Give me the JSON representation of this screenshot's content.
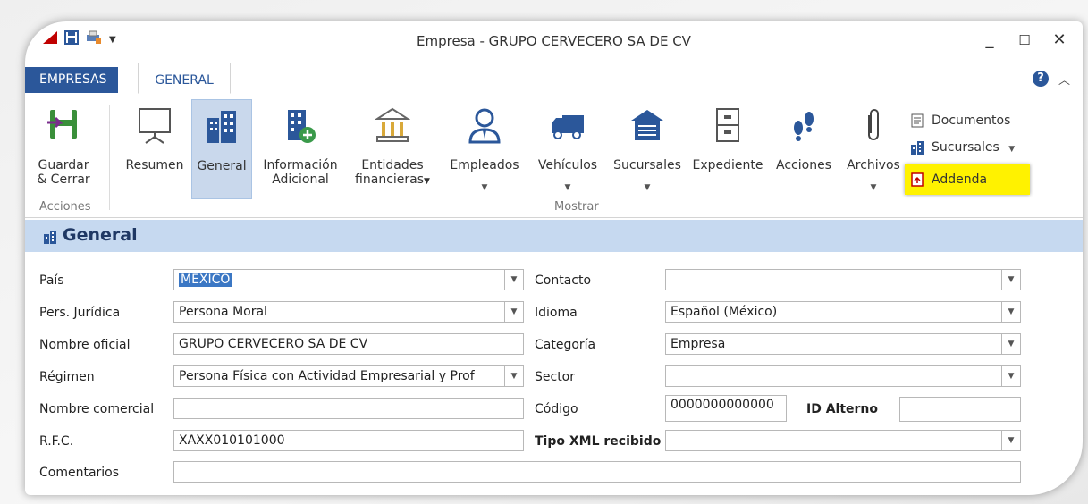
{
  "window": {
    "title": "Empresa - GRUPO CERVECERO SA DE CV"
  },
  "tabs": {
    "empresas": "EMPRESAS",
    "general": "GENERAL"
  },
  "ribbon": {
    "save_close": [
      "Guardar",
      "& Cerrar"
    ],
    "group_acciones": "Acciones",
    "resumen": "Resumen",
    "general": "General",
    "info": [
      "Información",
      "Adicional"
    ],
    "entidades": [
      "Entidades",
      "financieras"
    ],
    "empleados": "Empleados",
    "vehiculos": "Vehículos",
    "sucursales": "Sucursales",
    "expediente": "Expediente",
    "acciones": "Acciones",
    "archivos": "Archivos",
    "group_mostrar": "Mostrar",
    "documentos": "Documentos",
    "sucursales_small": "Sucursales",
    "addenda": "Addenda"
  },
  "section": {
    "title": "General"
  },
  "form": {
    "pais": {
      "label": "País",
      "value": "MEXICO"
    },
    "pers_juridica": {
      "label": "Pers. Jurídica",
      "value": "Persona Moral"
    },
    "nombre_oficial": {
      "label": "Nombre oficial",
      "value": "GRUPO CERVECERO SA DE CV"
    },
    "regimen": {
      "label": "Régimen",
      "value": "Persona Física con Actividad Empresarial y Prof"
    },
    "nombre_comercial": {
      "label": "Nombre comercial",
      "value": ""
    },
    "rfc": {
      "label": "R.F.C.",
      "value": "XAXX010101000"
    },
    "comentarios": {
      "label": "Comentarios",
      "value": ""
    },
    "contacto": {
      "label": "Contacto",
      "value": ""
    },
    "idioma": {
      "label": "Idioma",
      "value": "Español (México)"
    },
    "categoria": {
      "label": "Categoría",
      "value": "Empresa"
    },
    "sector": {
      "label": "Sector",
      "value": ""
    },
    "codigo": {
      "label": "Código",
      "value": "0000000000000"
    },
    "id_alterno": {
      "label": "ID Alterno",
      "value": ""
    },
    "tipo_xml": {
      "label": "Tipo XML recibido",
      "value": ""
    }
  },
  "colors": {
    "accent": "#2b579a",
    "section_bg": "#c6d9f0",
    "highlight": "#fff200"
  }
}
